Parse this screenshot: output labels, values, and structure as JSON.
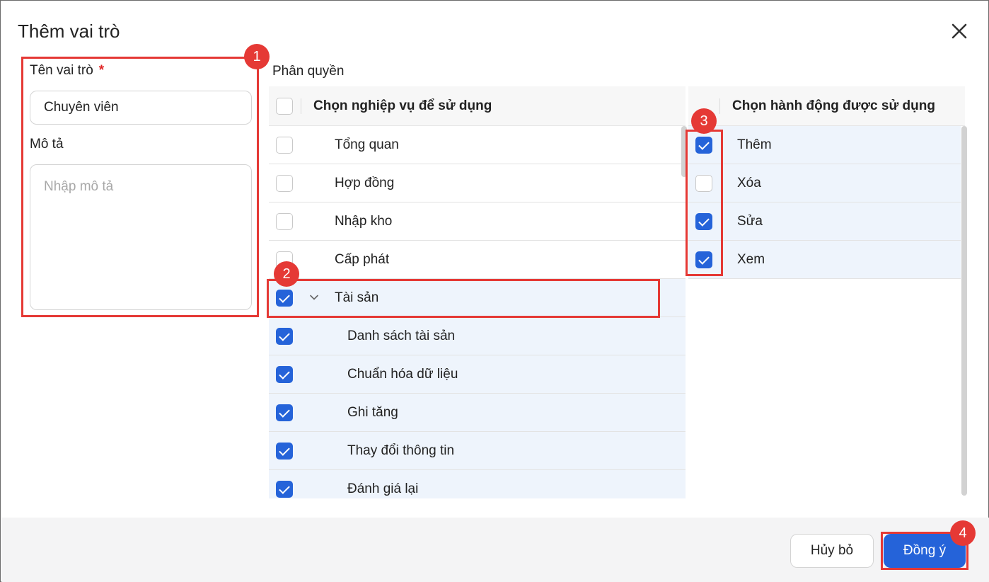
{
  "dialog": {
    "title": "Thêm vai trò",
    "close_icon": "close-icon"
  },
  "form": {
    "role_name_label": "Tên vai trò",
    "required_mark": "*",
    "role_name_value": "Chuyên viên",
    "description_label": "Mô tả",
    "description_placeholder": "Nhập mô tả"
  },
  "permissions": {
    "section_label": "Phân quyền",
    "modules_header": "Chọn nghiệp vụ để sử dụng",
    "actions_header": "Chọn hành động được sử dụng",
    "modules": [
      {
        "label": "Tổng quan",
        "checked": false,
        "level": 0
      },
      {
        "label": "Hợp đồng",
        "checked": false,
        "level": 0
      },
      {
        "label": "Nhập kho",
        "checked": false,
        "level": 0
      },
      {
        "label": "Cấp phát",
        "checked": false,
        "level": 0
      },
      {
        "label": "Tài sản",
        "checked": true,
        "level": 0,
        "expanded": true
      },
      {
        "label": "Danh sách tài sản",
        "checked": true,
        "level": 1
      },
      {
        "label": "Chuẩn hóa dữ liệu",
        "checked": true,
        "level": 1
      },
      {
        "label": "Ghi tăng",
        "checked": true,
        "level": 1
      },
      {
        "label": "Thay đổi thông tin",
        "checked": true,
        "level": 1
      },
      {
        "label": "Đánh giá lại",
        "checked": true,
        "level": 1
      }
    ],
    "actions": [
      {
        "label": "Thêm",
        "checked": true
      },
      {
        "label": "Xóa",
        "checked": false
      },
      {
        "label": "Sửa",
        "checked": true
      },
      {
        "label": "Xem",
        "checked": true
      }
    ]
  },
  "footer": {
    "cancel_label": "Hủy bỏ",
    "ok_label": "Đồng ý"
  },
  "annotations": [
    "1",
    "2",
    "3",
    "4"
  ],
  "colors": {
    "primary": "#2563d9",
    "annotation": "#e53935",
    "selected_row": "#eef4fc"
  }
}
